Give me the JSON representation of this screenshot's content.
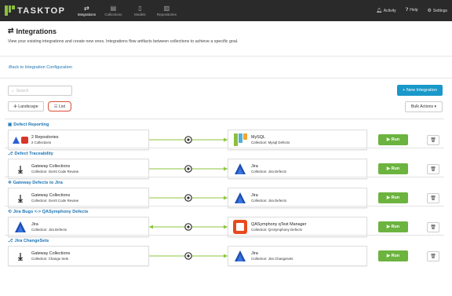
{
  "app": {
    "logo_text": "TASKTOP",
    "nav": [
      {
        "label": "Integrations",
        "icon": "integrations-icon",
        "active": true
      },
      {
        "label": "Collections",
        "icon": "collections-icon",
        "active": false
      },
      {
        "label": "Models",
        "icon": "models-icon",
        "active": false
      },
      {
        "label": "Repositories",
        "icon": "repositories-icon",
        "active": false
      }
    ],
    "right": {
      "activity": "Activity",
      "help": "Help",
      "settings": "Settings"
    }
  },
  "header": {
    "title": "Integrations",
    "description": "View your existing integrations and create new ones. Integrations flow artifacts between collections to achieve a specific goal."
  },
  "back_link": "Back to Integration Configuration",
  "toolbar": {
    "search_placeholder": "Search",
    "new_integration": "+ New Integration",
    "landscape": "Landscape",
    "list": "List",
    "bulk_actions": "Bulk Actions"
  },
  "colors": {
    "accent": "#1998c9",
    "run": "#6cb33f",
    "link": "#1c74b4",
    "connector": "#8dc63f"
  },
  "integrations": [
    {
      "title": "Defect Reporting",
      "left": {
        "name": "2 Repositories",
        "sub": "2 Collections",
        "logo": "multi-repo-icon"
      },
      "right": {
        "name": "MySQL",
        "sub": "Collection: Mysql Defects",
        "logo": "tasktop-icon"
      },
      "direction": "right",
      "run": "Run"
    },
    {
      "title": "Defect Traceability",
      "left": {
        "name": "Gateway Collections",
        "sub": "Collection: Gerrit Code Review",
        "logo": "gateway-icon"
      },
      "right": {
        "name": "Jira",
        "sub": "Collection: Jira Defects",
        "logo": "jira-icon"
      },
      "direction": "right",
      "run": "Run"
    },
    {
      "title": "Gateway Defects to Jira",
      "left": {
        "name": "Gateway Collections",
        "sub": "Collection: Gerrit Code Review",
        "logo": "gateway-icon"
      },
      "right": {
        "name": "Jira",
        "sub": "Collection: Jira Defects",
        "logo": "jira-icon"
      },
      "direction": "right",
      "run": "Run"
    },
    {
      "title": "Jira Bugs <-> QASymphony Defects",
      "left": {
        "name": "Jira",
        "sub": "Collection: Jira Defects",
        "logo": "jira-icon"
      },
      "right": {
        "name": "QASymphony qTest Manager",
        "sub": "Collection: QASymphony Defects",
        "logo": "qasymphony-icon"
      },
      "direction": "both",
      "run": "Run"
    },
    {
      "title": "Jira ChangeSets",
      "left": {
        "name": "Gateway Collections",
        "sub": "Collection: Change Sets",
        "logo": "gateway-icon"
      },
      "right": {
        "name": "Jira",
        "sub": "Collection: Jira Changesets",
        "logo": "jira-icon"
      },
      "direction": "right",
      "run": "Run"
    }
  ]
}
